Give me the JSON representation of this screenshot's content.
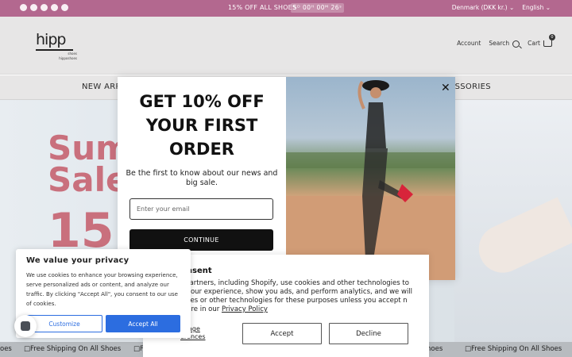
{
  "announcement": {
    "text": "15% OFF ALL SHOES",
    "countdown": "5ᴰ 00ᴴ 00ᴹ 26ˢ",
    "currency": "Denmark (DKK kr.) ⌄",
    "language": "English ⌄",
    "social_icons": [
      "facebook-icon",
      "youtube-icon",
      "instagram-icon",
      "tiktok-icon",
      "pinterest-icon"
    ],
    "bg_color": "#b3688f"
  },
  "header": {
    "logo_main": "hipp",
    "logo_sub1": "shoes",
    "logo_sub2": "hipposhoes",
    "account_label": "Account",
    "search_label": "Search",
    "cart_label": "Cart",
    "cart_count": "0"
  },
  "nav": {
    "items": [
      "NEW ARR",
      "ESSORIES"
    ]
  },
  "hero": {
    "line1": "Sum",
    "line2": "Sale",
    "line3": "15",
    "accent": "#c9707d"
  },
  "marquee": {
    "item": "□Free Shipping On All Shoes",
    "fragment_left": "oes",
    "fragment_mid": "□F",
    "fragment_mid2": "hoes"
  },
  "popup": {
    "heading_lines": [
      "GET 10% OFF",
      "YOUR FIRST",
      "ORDER"
    ],
    "subtitle": "Be the first to know about our news and big sale.",
    "email_placeholder": "Enter your email",
    "continue_label": "CONTINUE",
    "close_label": "✕"
  },
  "cookie_left": {
    "title": "We value your privacy",
    "body": "We use cookies to enhance your browsing experience, serve personalized ads or content, and analyze our traffic. By clicking \"Accept All\", you consent to our use of cookies.",
    "customize_label": "Customize",
    "accept_all_label": "Accept All",
    "accent": "#2c6de0"
  },
  "cookie_right": {
    "title": "onsent",
    "body": "r partners, including Shopify, use cookies and other technologies to e your experience, show you ads, and perform analytics, and we will okies or other technologies for these purposes unless you accept n more in our",
    "privacy_link": "Privacy Policy",
    "manage_label": "anage\nerences",
    "accept_label": "Accept",
    "decline_label": "Decline"
  }
}
